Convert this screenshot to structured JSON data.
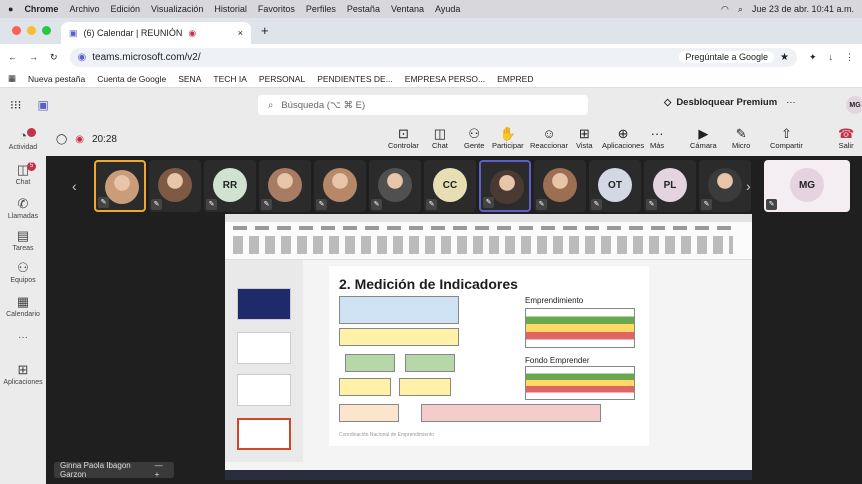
{
  "menubar": {
    "app": "Chrome",
    "items": [
      "Archivo",
      "Edición",
      "Visualización",
      "Historial",
      "Favoritos",
      "Perfiles",
      "Pestaña",
      "Ventana",
      "Ayuda"
    ],
    "datetime": "Jue 23 de abr. 10:41 a.m."
  },
  "tab": {
    "title": "(6) Calendar | REUNIÓN",
    "close": "×",
    "new": "+"
  },
  "address": {
    "url": "teams.microsoft.com/v2/",
    "gemini": "Pregúntale a Google"
  },
  "bookmarks": [
    "Nueva pestaña",
    "Cuenta de Google",
    "SENA",
    "TECH IA",
    "PERSONAL",
    "PENDIENTES DE...",
    "EMPRESA PERSO...",
    "EMPRED"
  ],
  "teams": {
    "search_placeholder": "Búsqueda (⌥ ⌘ E)",
    "premium": "Desbloquear Premium",
    "more": "···",
    "avatar": "MG"
  },
  "rail": [
    {
      "label": "Actividad",
      "badge": ""
    },
    {
      "label": "Chat",
      "badge": "5"
    },
    {
      "label": "Llamadas",
      "badge": ""
    },
    {
      "label": "Tareas",
      "badge": ""
    },
    {
      "label": "Equipos",
      "badge": ""
    },
    {
      "label": "Calendario",
      "badge": ""
    },
    {
      "label": "···",
      "badge": ""
    },
    {
      "label": "Aplicaciones",
      "badge": ""
    }
  ],
  "meeting": {
    "timer": "20:28",
    "tools": [
      "Controlar",
      "Chat",
      "Gente",
      "Participar",
      "Reaccionar",
      "Vista",
      "Aplicaciones",
      "Más",
      "Cámara",
      "Micro",
      "Compartir",
      "Salir"
    ]
  },
  "participants": [
    {
      "type": "photo",
      "color": "#c99c7a",
      "initials": ""
    },
    {
      "type": "photo",
      "color": "#7e5a45",
      "initials": ""
    },
    {
      "type": "initials",
      "color": "#cfe3d0",
      "initials": "RR"
    },
    {
      "type": "photo",
      "color": "#a77c63",
      "initials": ""
    },
    {
      "type": "photo",
      "color": "#b58967",
      "initials": ""
    },
    {
      "type": "photo",
      "color": "#505050",
      "initials": ""
    },
    {
      "type": "initials",
      "color": "#e7dfb3",
      "initials": "CC"
    },
    {
      "type": "photo",
      "color": "#4a3a33",
      "initials": ""
    },
    {
      "type": "photo",
      "color": "#9d6f52",
      "initials": ""
    },
    {
      "type": "initials",
      "color": "#d4d8e4",
      "initials": "OT"
    },
    {
      "type": "initials",
      "color": "#e4d4e0",
      "initials": "PL"
    },
    {
      "type": "photo",
      "color": "#3b3b3b",
      "initials": ""
    },
    {
      "type": "initials",
      "color": "#e4d4e0",
      "initials": "MG"
    }
  ],
  "slide": {
    "title": "2. Medición de Indicadores",
    "section1": "Emprendimiento",
    "section2": "Fondo Emprender",
    "footer": "Coordinación Nacional de Emprendimiento"
  },
  "presenter": {
    "name": "Ginna Paola Ibagon Garzon",
    "more": "— +"
  }
}
